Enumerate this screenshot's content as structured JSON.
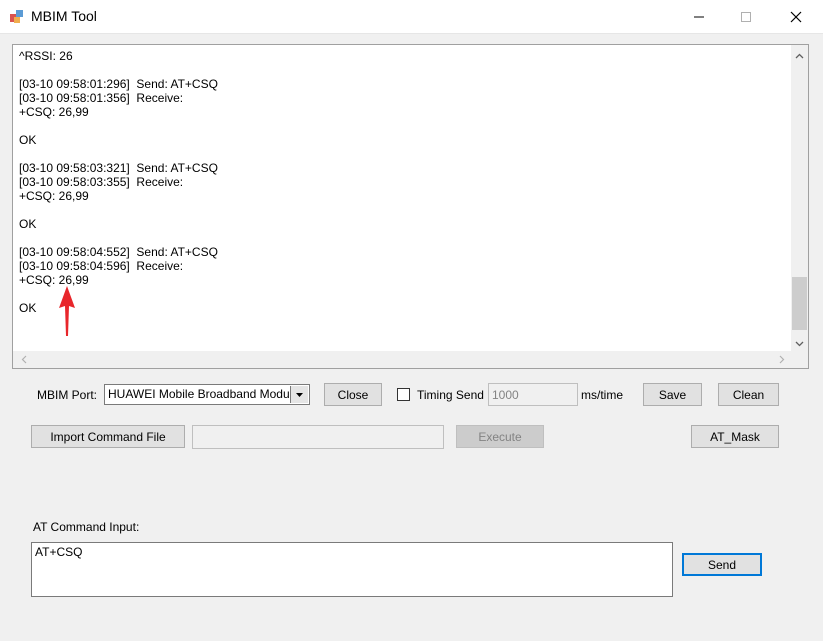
{
  "window": {
    "title": "MBIM Tool"
  },
  "log": {
    "lines": [
      "^RSSI: 26",
      "",
      "[03-10 09:58:01:296]  Send: AT+CSQ",
      "[03-10 09:58:01:356]  Receive:",
      "+CSQ: 26,99",
      "",
      "OK",
      "",
      "[03-10 09:58:03:321]  Send: AT+CSQ",
      "[03-10 09:58:03:355]  Receive:",
      "+CSQ: 26,99",
      "",
      "OK",
      "",
      "[03-10 09:58:04:552]  Send: AT+CSQ",
      "[03-10 09:58:04:596]  Receive:",
      "+CSQ: 26,99",
      "",
      "OK"
    ]
  },
  "controls": {
    "port_label": "MBIM Port:",
    "port_value": "HUAWEI Mobile Broadband Module",
    "close_label": "Close",
    "timing_send_label": "Timing Send",
    "timing_value": "1000",
    "ms_time_label": "ms/time",
    "save_label": "Save",
    "clean_label": "Clean",
    "import_label": "Import Command File",
    "import_path": "",
    "execute_label": "Execute",
    "at_mask_label": "AT_Mask"
  },
  "input": {
    "label": "AT Command Input:",
    "value": "AT+CSQ",
    "send_label": "Send"
  },
  "colors": {
    "annotation_arrow": "#e8262b",
    "focus_border": "#0078d7"
  }
}
